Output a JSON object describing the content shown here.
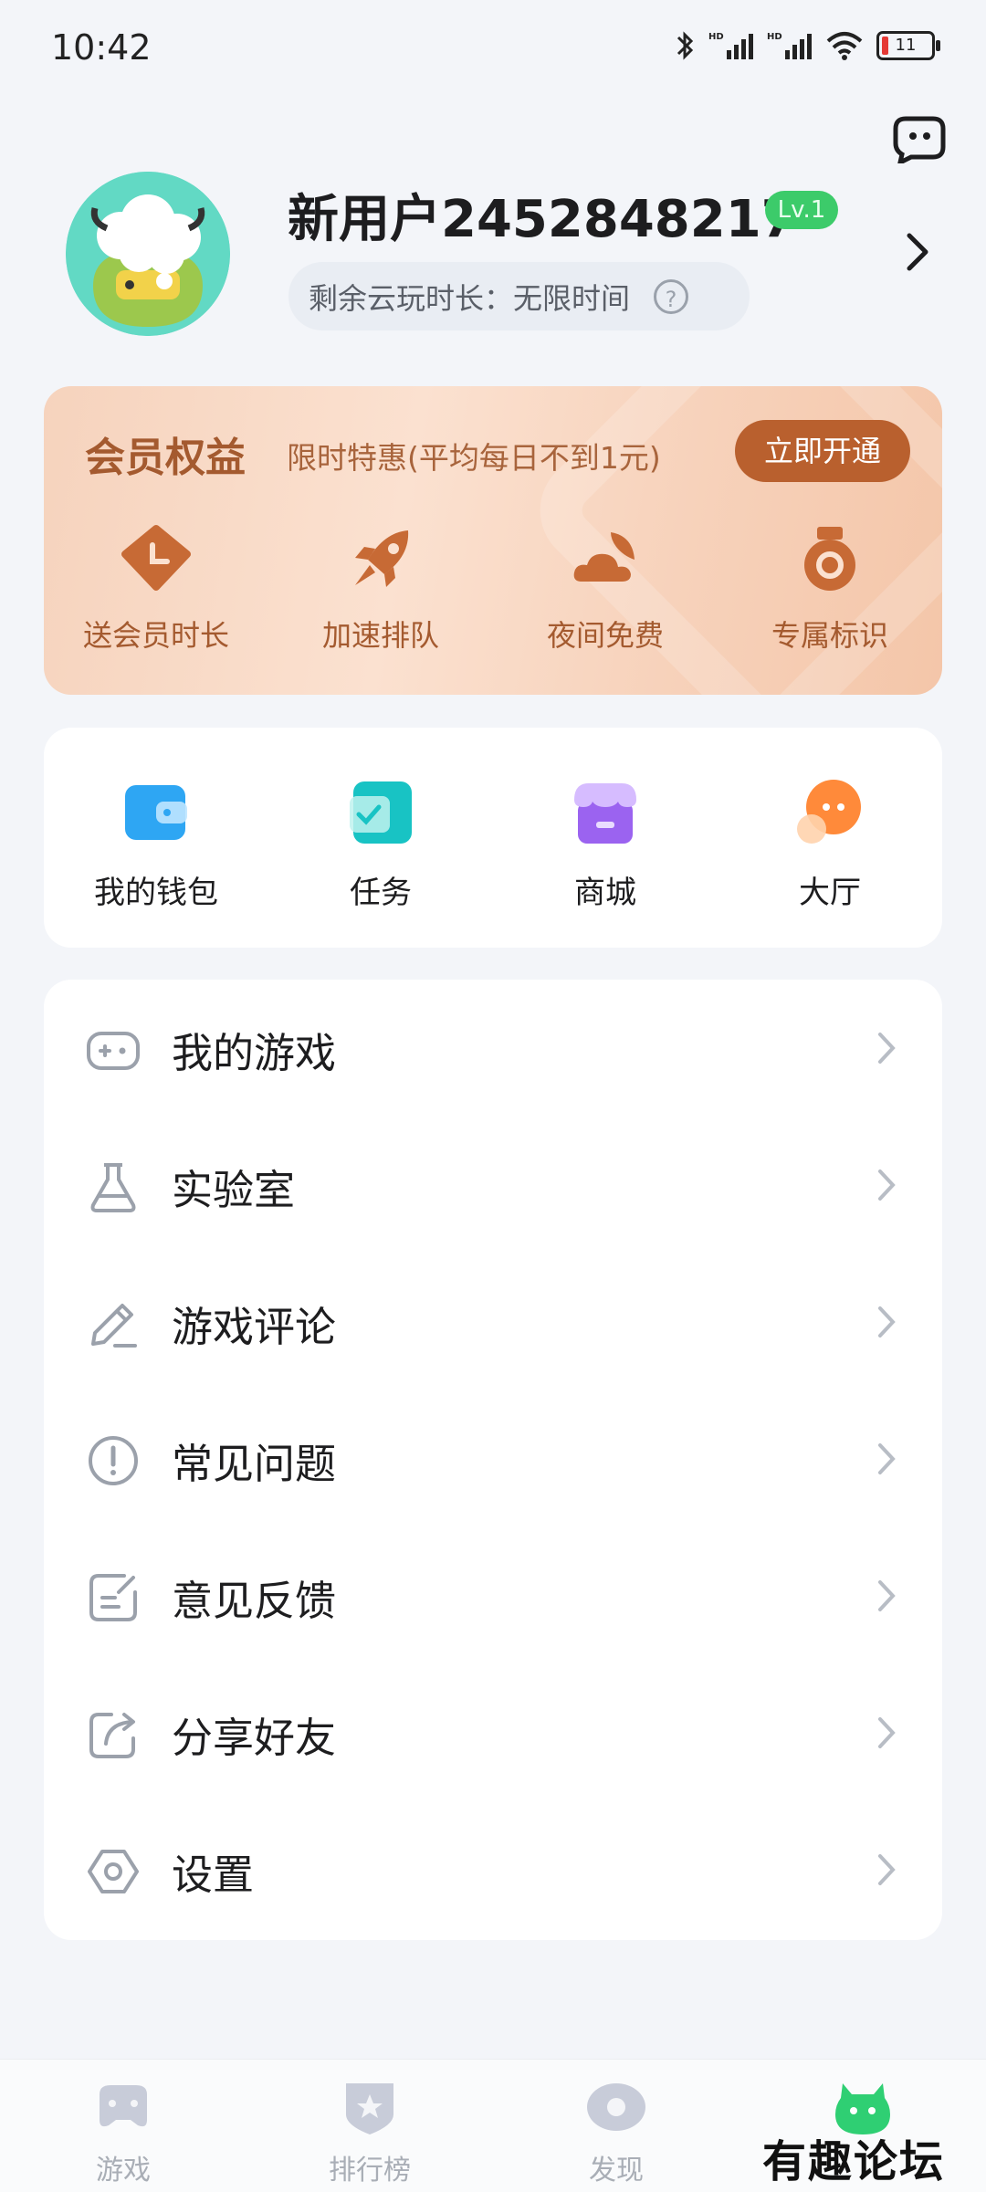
{
  "status_bar": {
    "time": "10:42",
    "battery": "11"
  },
  "profile": {
    "username": "新用户2452848217",
    "level": "Lv.1",
    "playtime_text": "剩余云玩时长：无限时间"
  },
  "member": {
    "title": "会员权益",
    "promo": "限时特惠(平均每日不到1元)",
    "activate_label": "立即开通",
    "perks": [
      {
        "label": "送会员时长",
        "icon": "clock-tag-icon"
      },
      {
        "label": "加速排队",
        "icon": "rocket-icon"
      },
      {
        "label": "夜间免费",
        "icon": "cloud-moon-icon"
      },
      {
        "label": "专属标识",
        "icon": "medal-icon"
      }
    ]
  },
  "quick_entries": [
    {
      "label": "我的钱包",
      "icon": "wallet-icon",
      "color": "#2ea6f3"
    },
    {
      "label": "任务",
      "icon": "task-icon",
      "color": "#18c3c4"
    },
    {
      "label": "商城",
      "icon": "shop-icon",
      "color": "#9b63f0"
    },
    {
      "label": "大厅",
      "icon": "chat-bubble-icon",
      "color": "#ff8a3a"
    }
  ],
  "menu": [
    {
      "label": "我的游戏",
      "icon": "gamepad-icon"
    },
    {
      "label": "实验室",
      "icon": "flask-icon"
    },
    {
      "label": "游戏评论",
      "icon": "pencil-icon"
    },
    {
      "label": "常见问题",
      "icon": "exclamation-circle-icon"
    },
    {
      "label": "意见反馈",
      "icon": "feedback-icon"
    },
    {
      "label": "分享好友",
      "icon": "share-icon"
    },
    {
      "label": "设置",
      "icon": "gear-icon"
    }
  ],
  "bottom_nav": [
    {
      "label": "游戏",
      "icon": "gamepad-tab-icon"
    },
    {
      "label": "排行榜",
      "icon": "ranking-shield-icon"
    },
    {
      "label": "发现",
      "icon": "eye-icon"
    },
    {
      "label": "",
      "icon": "monster-avatar-icon",
      "active": true
    }
  ],
  "watermark": "有趣论坛"
}
